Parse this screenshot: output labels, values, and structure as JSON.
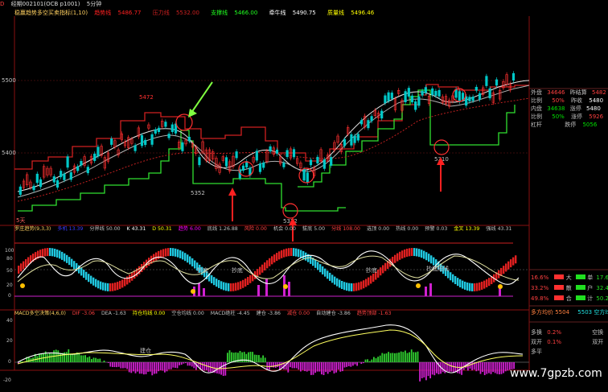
{
  "topbar": {
    "icon_text": "D",
    "title": "经期002101(OCB p1001)",
    "period": "5分钟"
  },
  "main_chart": {
    "indicator_name": "稳赢趋势多空买卖指标(1,10)",
    "legend": [
      {
        "label": "趋势线",
        "value": "5486.77",
        "color": "#ff2020"
      },
      {
        "label": "压力线",
        "value": "5532.00",
        "color": "#cc2020"
      },
      {
        "label": "支撑线",
        "value": "5466.00",
        "color": "#20ff20"
      },
      {
        "label": "牵牛线",
        "value": "5490.75",
        "color": "#ffffff"
      },
      {
        "label": "质量线",
        "value": "5496.46",
        "color": "#ffff00"
      }
    ],
    "y_ticks": [
      "5500",
      "5400"
    ],
    "high_label": "5472",
    "low_label": "5352",
    "low_label2": "5312",
    "low_label3": "5310",
    "bottom_left_label": "5天"
  },
  "mid_chart": {
    "indicator_name": "罗庄趋势(9,3,3)",
    "legend_items": [
      {
        "text": "多机 13.39",
        "color": "#3c3cff"
      },
      {
        "text": "分界线 50.00",
        "color": "#c0c0c0"
      },
      {
        "text": "K 43.31",
        "color": "#ffffff"
      },
      {
        "text": "D 50.31",
        "color": "#ffff00"
      },
      {
        "text": "趋势 6.00",
        "color": "#ff00ff"
      },
      {
        "text": "底线 1.26.88",
        "color": "#c0c0c0"
      },
      {
        "text": "风险 0.00",
        "color": "#ff4040"
      },
      {
        "text": "机会 0.00",
        "color": "#c0c0c0"
      },
      {
        "text": "拔底 5.00",
        "color": "#c0c0c0"
      },
      {
        "text": "分线 108.00",
        "color": "#ff4040"
      },
      {
        "text": "选顶 0.00",
        "color": "#c0c0c0"
      },
      {
        "text": "热线 0.00",
        "color": "#c0c0c0"
      },
      {
        "text": "预警 0.03",
        "color": "#c0c0c0"
      },
      {
        "text": "金叉 13.39",
        "color": "#ffff00"
      },
      {
        "text": "强线 43.31",
        "color": "#c0c0c0"
      }
    ],
    "y_ticks": [
      "100",
      "80",
      "50",
      "20",
      "0"
    ],
    "annotations": [
      "抄底",
      "抄底",
      "抄底",
      "抄底短线"
    ]
  },
  "macd_chart": {
    "indicator_name": "MACD多空决策(4,6,0)",
    "legend_items": [
      {
        "text": "DIF -3.06",
        "color": "#ff4040"
      },
      {
        "text": "DEA -1.63",
        "color": "#c0c0c0"
      },
      {
        "text": "持仓均线 0.00",
        "color": "#ffff00"
      },
      {
        "text": "空仓均线 0.00",
        "color": "#c0c0c0"
      },
      {
        "text": "MACD绝柱 -4.45",
        "color": "#c0c0c0"
      },
      {
        "text": "建仓 -3.86",
        "color": "#c0c0c0"
      },
      {
        "text": "减仓 0.00",
        "color": "#ff4040"
      },
      {
        "text": "自动建仓 -3.86",
        "color": "#c0c0c0"
      },
      {
        "text": "趋势顶部 -1.63",
        "color": "#ff4040"
      }
    ],
    "y_ticks": [
      "40",
      "20",
      "0",
      "-20"
    ],
    "annotation": "建仓"
  },
  "right_panel": {
    "rows": [
      {
        "l": "外盘",
        "v1": "34646",
        "l2": "昨结算",
        "v2": "5482"
      },
      {
        "l": "比例",
        "v1": "50%",
        "l2": "昨收",
        "v2": "5480"
      },
      {
        "l": "内盘",
        "v1": "34638",
        "l2": "涨停",
        "v2": "5480"
      },
      {
        "l": "比例",
        "v1": "50%",
        "l2": "涨停",
        "v2": "5926"
      },
      {
        "l": "杠杆",
        "v1": "",
        "l2": "跌停",
        "v2": "5056"
      }
    ],
    "stats": [
      {
        "pct": "16.6%",
        "name": "大",
        "side": "单",
        "pct2": "17.6%"
      },
      {
        "pct": "33.2%",
        "name": "散",
        "side": "户",
        "pct2": "32.4%"
      },
      {
        "pct": "49.8%",
        "name": "合",
        "side": "计",
        "pct2": "50.2%"
      }
    ],
    "avg_line": {
      "left": "多方均价 5504",
      "right": "5503 空方均价"
    },
    "bottom_rows": [
      {
        "l": "多换",
        "v": "0.2%",
        "r": "空换"
      },
      {
        "l": "双开",
        "v": "0.1%",
        "r": "双开"
      },
      {
        "l": "多平",
        "v": "",
        "r": ""
      }
    ]
  },
  "watermark": "www.7gpzb.com",
  "colors": {
    "up": "#ff3030",
    "down": "#00c8c8",
    "support": "#30e030",
    "trend": "#ff2020",
    "accent_green": "#80ff40"
  }
}
